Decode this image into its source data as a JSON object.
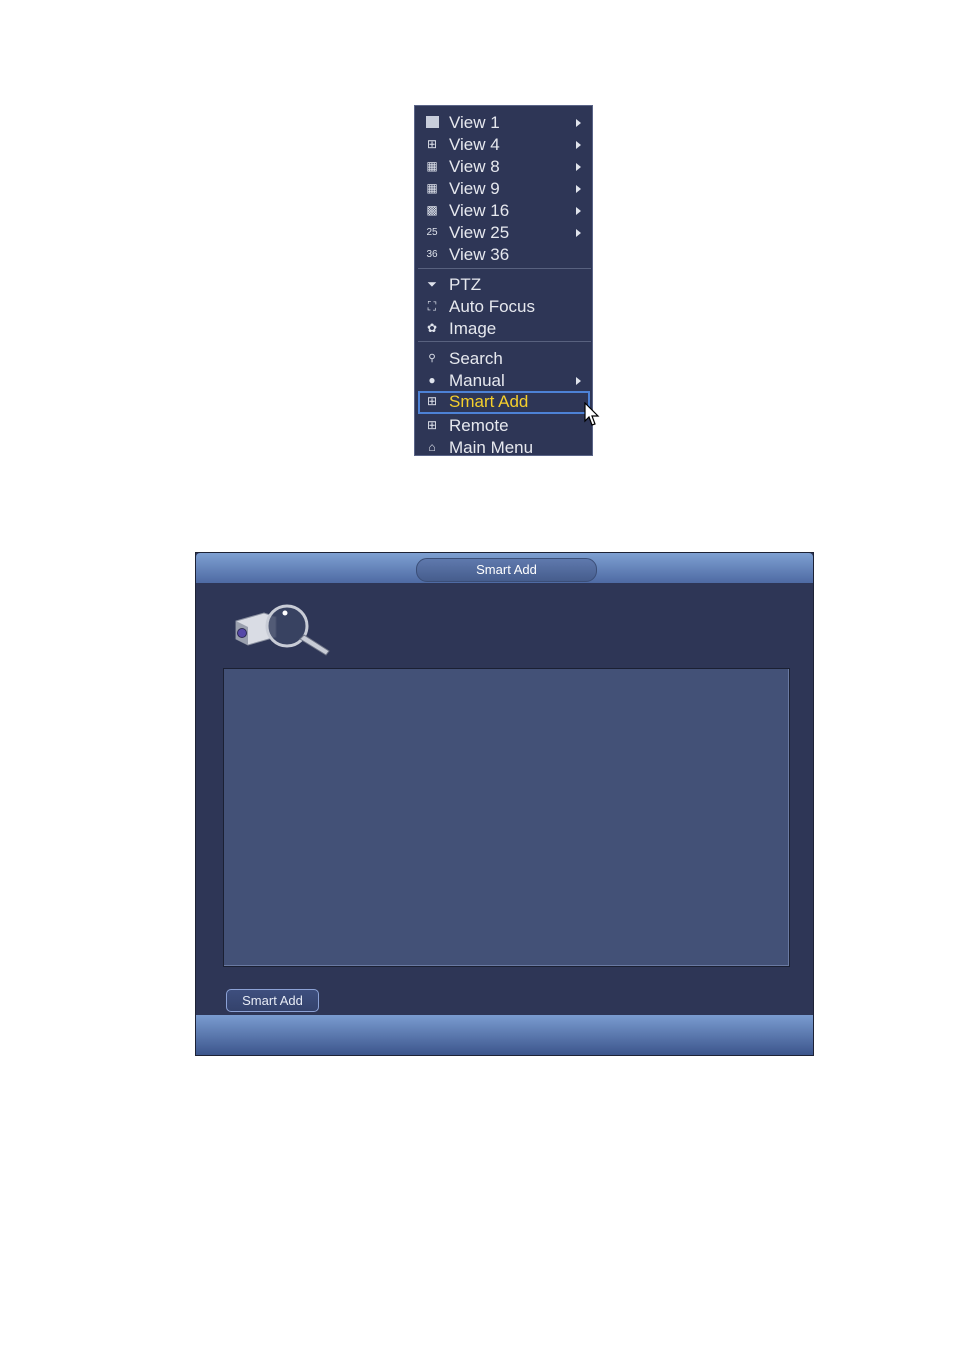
{
  "context_menu": {
    "items": [
      {
        "label": "View 1",
        "icon": "single-view-icon",
        "glyph": "■",
        "submenu": true
      },
      {
        "label": "View 4",
        "icon": "quad-view-icon",
        "glyph": "⊞",
        "submenu": true
      },
      {
        "label": "View 8",
        "icon": "eight-view-icon",
        "glyph": "▦",
        "submenu": true
      },
      {
        "label": "View 9",
        "icon": "nine-view-icon",
        "glyph": "▦",
        "submenu": true
      },
      {
        "label": "View 16",
        "icon": "sixteen-view-icon",
        "glyph": "▩",
        "submenu": true
      },
      {
        "label": "View 25",
        "icon": "twentyfive-view-icon",
        "glyph": "25",
        "submenu": true
      },
      {
        "label": "View 36",
        "icon": "thirtysix-view-icon",
        "glyph": "36",
        "submenu": false
      },
      {
        "label": "PTZ",
        "icon": "ptz-dome-icon",
        "glyph": "⏷",
        "submenu": false
      },
      {
        "label": "Auto Focus",
        "icon": "auto-focus-icon",
        "glyph": "⛶",
        "submenu": false
      },
      {
        "label": "Image",
        "icon": "palette-icon",
        "glyph": "✿",
        "submenu": false
      },
      {
        "label": "Search",
        "icon": "search-icon",
        "glyph": "🔍",
        "submenu": false
      },
      {
        "label": "Manual",
        "icon": "mouse-icon",
        "glyph": "●",
        "submenu": true
      },
      {
        "label": "Smart Add",
        "icon": "add-device-icon",
        "glyph": "⊞",
        "submenu": false,
        "selected": true
      },
      {
        "label": "Remote",
        "icon": "remote-device-icon",
        "glyph": "⊞",
        "submenu": false
      },
      {
        "label": "Main Menu",
        "icon": "home-icon",
        "glyph": "⌂",
        "submenu": false
      }
    ],
    "selected_color": "#f5cf2c"
  },
  "dialog": {
    "title": "Smart Add",
    "button_label": "Smart Add"
  }
}
